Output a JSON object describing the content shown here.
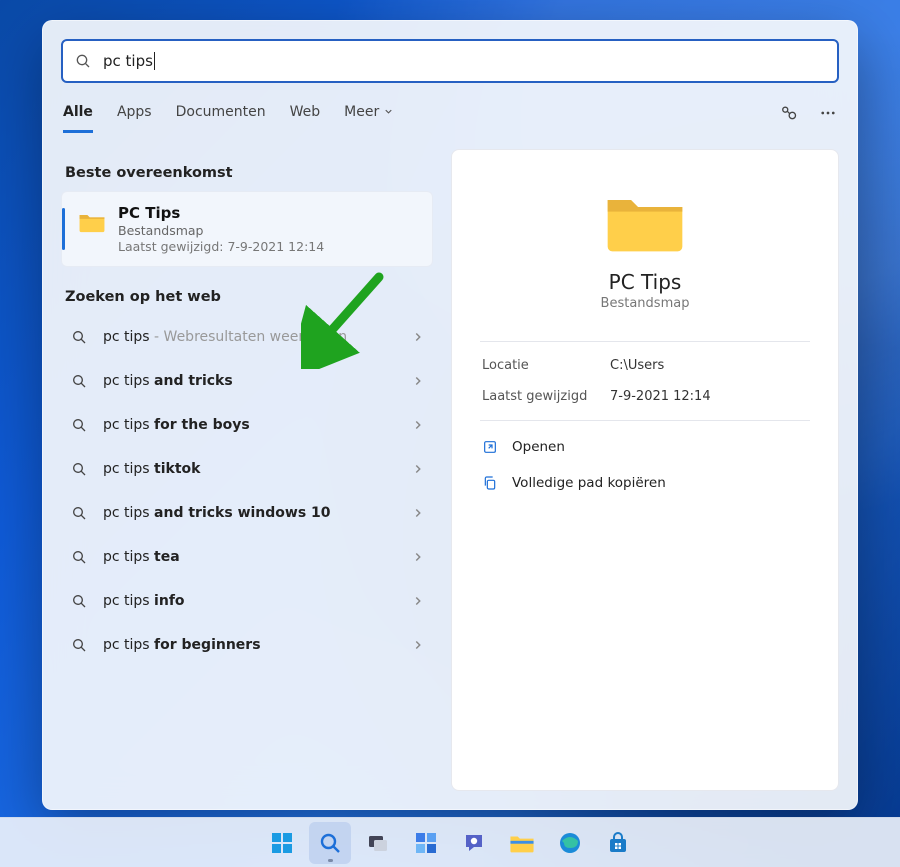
{
  "search": {
    "value": "pc tips"
  },
  "tabs": {
    "items": [
      "Alle",
      "Apps",
      "Documenten",
      "Web",
      "Meer"
    ],
    "active_index": 0
  },
  "sections": {
    "best_match": "Beste overeenkomst",
    "web_search": "Zoeken op het web"
  },
  "best_match": {
    "title": "PC Tips",
    "subtitle": "Bestandsmap",
    "modified_label": "Laatst gewijzigd: 7-9-2021 12:14"
  },
  "web_results": [
    {
      "base": "pc tips",
      "bold": "",
      "muted": " - Webresultaten weergeven"
    },
    {
      "base": "pc tips ",
      "bold": "and tricks",
      "muted": ""
    },
    {
      "base": "pc tips ",
      "bold": "for the boys",
      "muted": ""
    },
    {
      "base": "pc tips ",
      "bold": "tiktok",
      "muted": ""
    },
    {
      "base": "pc tips ",
      "bold": "and tricks windows 10",
      "muted": ""
    },
    {
      "base": "pc tips ",
      "bold": "tea",
      "muted": ""
    },
    {
      "base": "pc tips ",
      "bold": "info",
      "muted": ""
    },
    {
      "base": "pc tips ",
      "bold": "for beginners",
      "muted": ""
    }
  ],
  "detail": {
    "title": "PC Tips",
    "subtitle": "Bestandsmap",
    "rows": [
      {
        "k": "Locatie",
        "v": "C:\\Users"
      },
      {
        "k": "Laatst gewijzigd",
        "v": "7-9-2021 12:14"
      }
    ],
    "actions": {
      "open": "Openen",
      "copy_path": "Volledige pad kopiëren"
    }
  }
}
